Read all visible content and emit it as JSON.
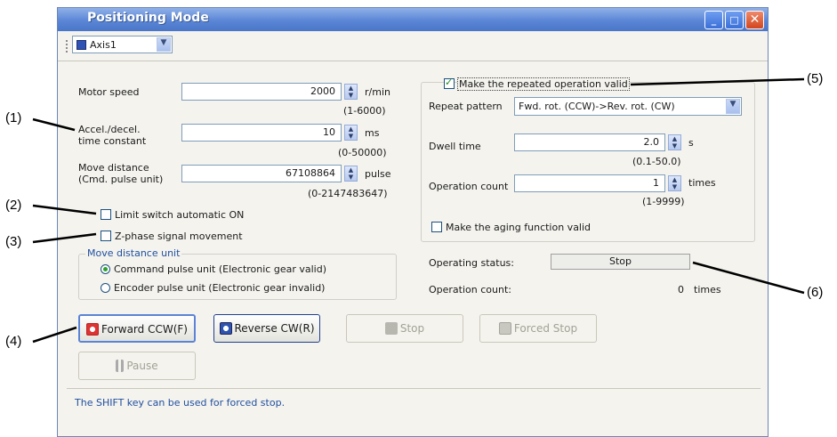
{
  "window": {
    "title": "Positioning Mode"
  },
  "toolbar": {
    "axis_value": "Axis1"
  },
  "left": {
    "motor_speed": {
      "label": "Motor speed",
      "value": "2000",
      "unit": "r/min",
      "range": "(1-6000)"
    },
    "accel": {
      "label_line1": "Accel./decel.",
      "label_line2": "time constant",
      "value": "10",
      "unit": "ms",
      "range": "(0-50000)"
    },
    "move_distance": {
      "label_line1": "Move distance",
      "label_line2": "(Cmd. pulse unit)",
      "value": "67108864",
      "unit": "pulse",
      "range": "(0-2147483647)"
    },
    "limit_switch": "Limit switch automatic ON",
    "z_phase": "Z-phase signal movement",
    "move_unit_group": "Move distance unit",
    "radio_command": "Command pulse unit (Electronic gear valid)",
    "radio_encoder": "Encoder pulse unit (Electronic gear invalid)"
  },
  "right": {
    "repeat_valid": "Make the repeated operation valid",
    "repeat_pattern": {
      "label": "Repeat pattern",
      "value": "Fwd. rot. (CCW)->Rev. rot. (CW)"
    },
    "dwell": {
      "label": "Dwell time",
      "value": "2.0",
      "unit": "s",
      "range": "(0.1-50.0)"
    },
    "op_count": {
      "label": "Operation count",
      "value": "1",
      "unit": "times",
      "range": "(1-9999)"
    },
    "aging": "Make the aging function valid"
  },
  "status": {
    "operating_label": "Operating status:",
    "operating_value": "Stop",
    "count_label": "Operation count:",
    "count_value": "0",
    "count_unit": "times"
  },
  "buttons": {
    "forward": "Forward CCW(F)",
    "reverse": "Reverse CW(R)",
    "stop": "Stop",
    "forced_stop": "Forced Stop",
    "pause": "Pause"
  },
  "footer": {
    "note": "The SHIFT key can be used for forced stop."
  },
  "callouts": [
    "(1)",
    "(2)",
    "(3)",
    "(4)",
    "(5)",
    "(6)"
  ]
}
